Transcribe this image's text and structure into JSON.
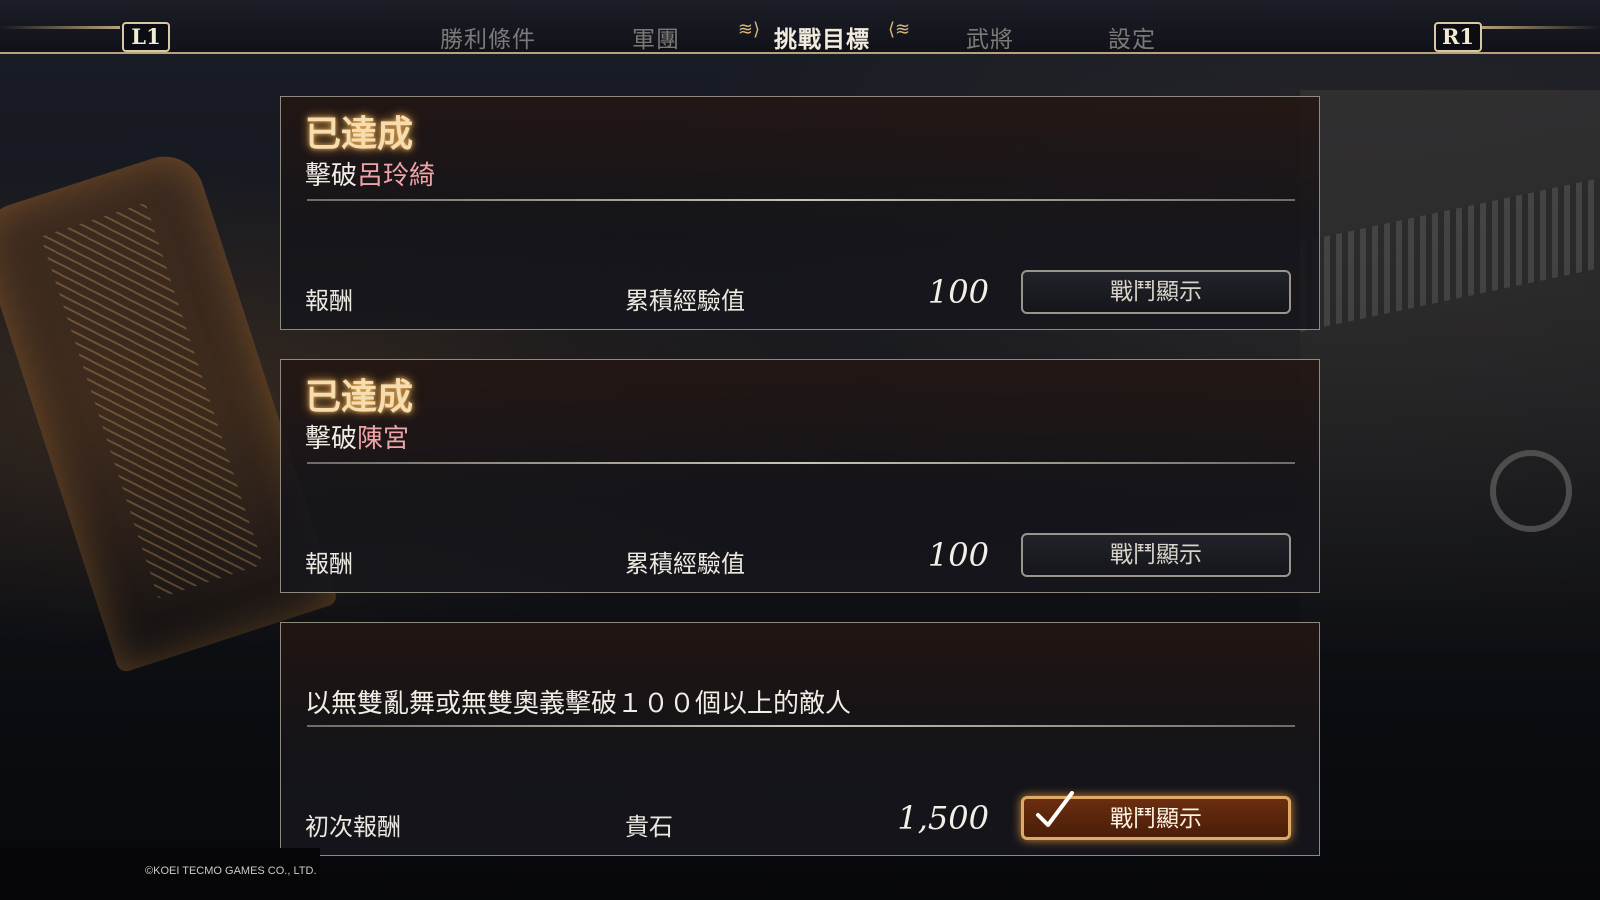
{
  "nav": {
    "left_button": "L1",
    "right_button": "R1",
    "tabs": [
      {
        "label": "勝利條件",
        "active": false
      },
      {
        "label": "軍團",
        "active": false
      },
      {
        "label": "挑戰目標",
        "active": true
      },
      {
        "label": "武將",
        "active": false
      },
      {
        "label": "設定",
        "active": false
      }
    ]
  },
  "missions": [
    {
      "status": "已達成",
      "objective_prefix": "擊破",
      "objective_target": "呂玲綺",
      "reward_label": "報酬",
      "reward_item": "累積經驗值",
      "reward_value": "100",
      "button_label": "戰鬥顯示"
    },
    {
      "status": "已達成",
      "objective_prefix": "擊破",
      "objective_target": "陳宮",
      "reward_label": "報酬",
      "reward_item": "累積經驗值",
      "reward_value": "100",
      "button_label": "戰鬥顯示"
    },
    {
      "status": "",
      "objective_text": "以無雙亂舞或無雙奧義擊破１００個以上的敵人",
      "reward_label": "初次報酬",
      "reward_item": "貴石",
      "reward_value": "1,500",
      "button_label": "戰鬥顯示",
      "button_checked": true
    }
  ],
  "footer": {
    "copyright": "©KOEI TECMO GAMES CO., LTD."
  },
  "colors": {
    "accent_gold": "#f6ddb0",
    "highlight_name": "#f0a3a7",
    "selected_button": "#6b2e10"
  }
}
